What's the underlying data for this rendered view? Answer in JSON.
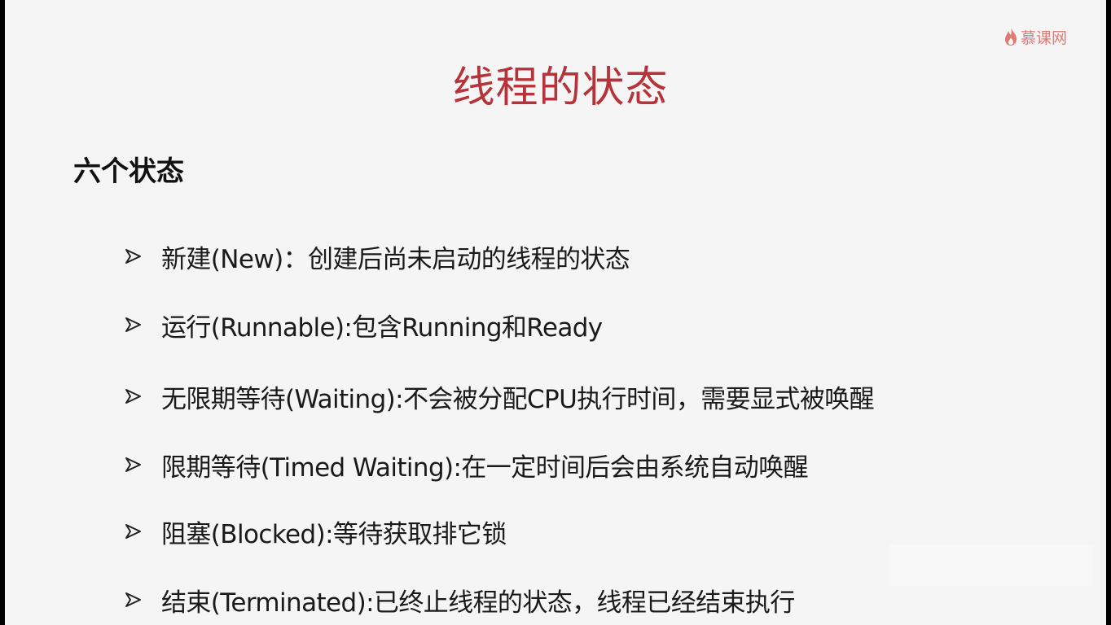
{
  "brand": {
    "logo_text": "慕课网",
    "logo_icon": "flame-icon",
    "accent_color": "#e07a74"
  },
  "slide": {
    "title": "线程的状态",
    "title_color": "#b5333a",
    "subheading": "六个状态",
    "bullet_icon": "arrow-right-bullet-icon",
    "items": [
      {
        "text": "新建(New)：创建后尚未启动的线程的状态"
      },
      {
        "text": "运行(Runnable):包含Running和Ready"
      },
      {
        "text": "无限期等待(Waiting):不会被分配CPU执行时间，需要显式被唤醒"
      },
      {
        "text": "限期等待(Timed Waiting):在一定时间后会由系统自动唤醒"
      },
      {
        "text": "阻塞(Blocked):等待获取排它锁"
      },
      {
        "text": "结束(Terminated):已终止线程的状态，线程已经结束执行"
      }
    ]
  }
}
